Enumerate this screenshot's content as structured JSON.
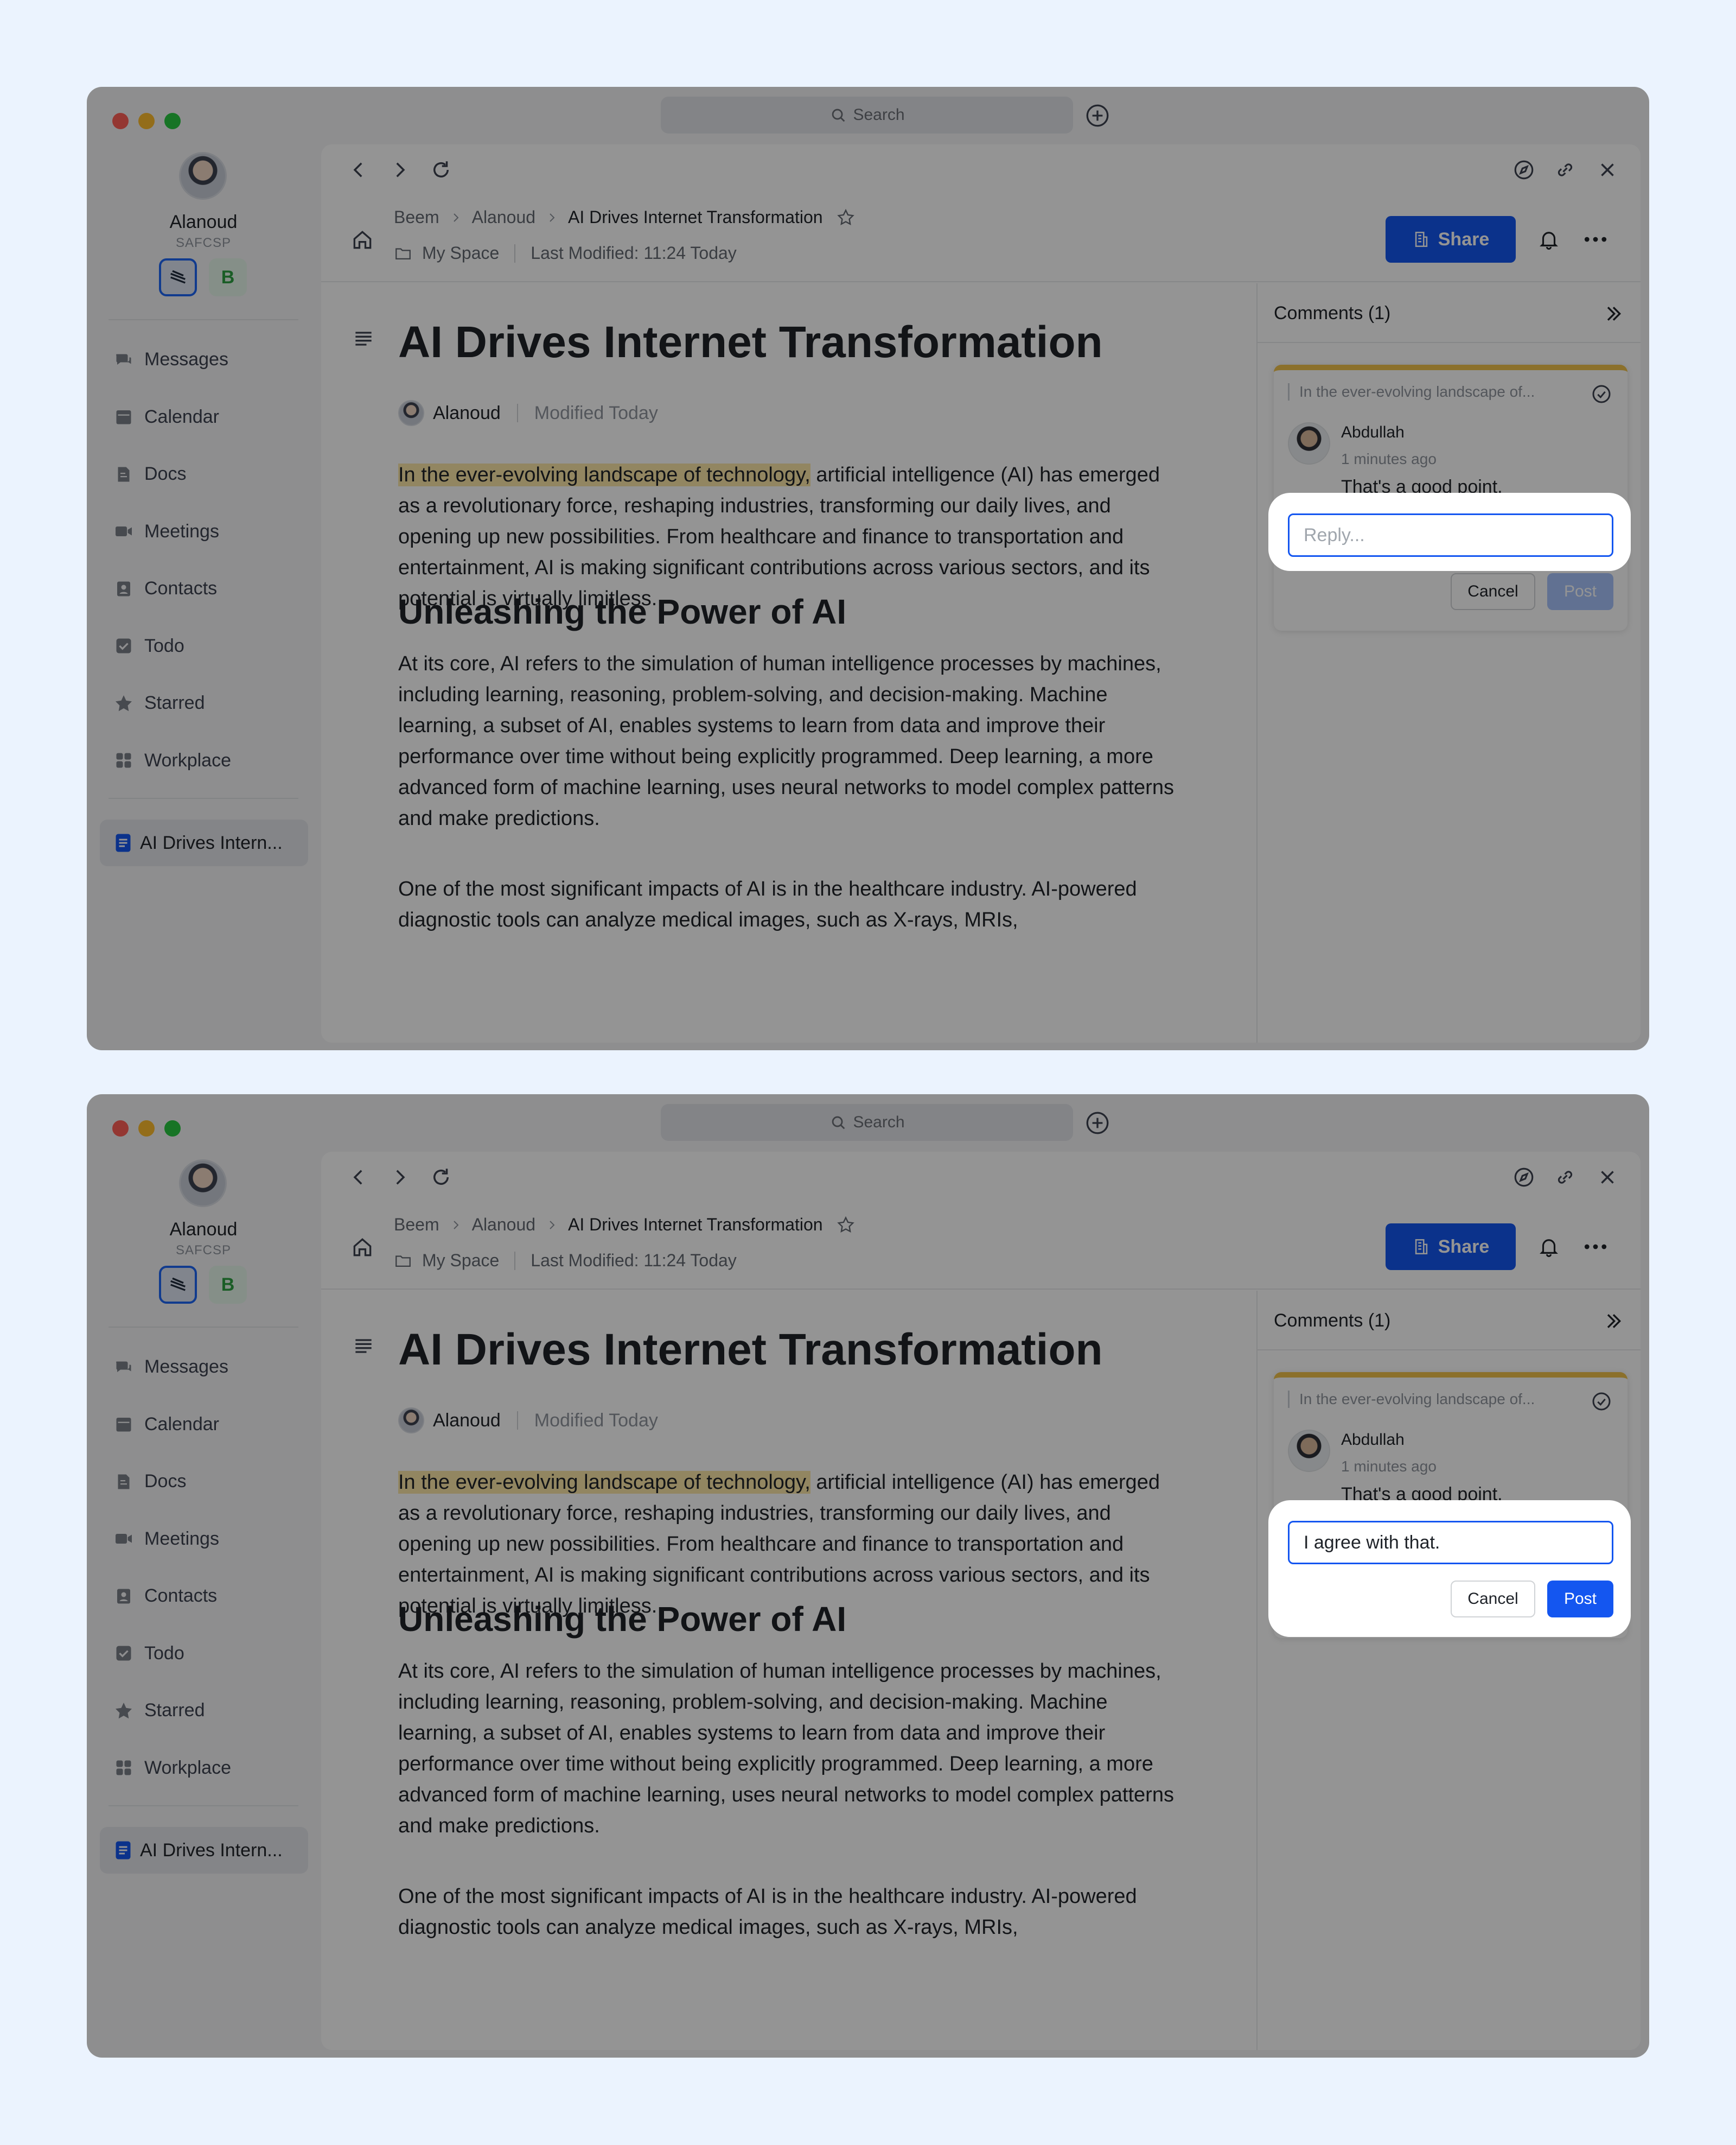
{
  "search": {
    "label": "Search"
  },
  "user": {
    "name": "Alanoud",
    "org": "SAFCSP",
    "workspace_badge": "B"
  },
  "nav": [
    {
      "label": "Messages",
      "icon": "chat-icon"
    },
    {
      "label": "Calendar",
      "icon": "calendar-icon"
    },
    {
      "label": "Docs",
      "icon": "docs-icon"
    },
    {
      "label": "Meetings",
      "icon": "video-icon"
    },
    {
      "label": "Contacts",
      "icon": "contacts-icon"
    },
    {
      "label": "Todo",
      "icon": "checkbox-icon"
    },
    {
      "label": "Starred",
      "icon": "star-icon"
    },
    {
      "label": "Workplace",
      "icon": "grid-icon"
    }
  ],
  "open_doc_tab": {
    "label": "AI Drives Intern..."
  },
  "breadcrumb": {
    "root": "Beem",
    "parent": "Alanoud",
    "current": "AI Drives Internet Transformation"
  },
  "meta": {
    "location": "My Space",
    "last_modified": "Last Modified: 11:24 Today"
  },
  "header": {
    "share_label": "Share"
  },
  "doc": {
    "title": "AI Drives Internet Transformation",
    "author": "Alanoud",
    "modified": "Modified Today",
    "p1_highlight": "In the ever-evolving landscape of technology,",
    "p1_rest": " artificial intelligence (AI) has emerged as a revolutionary force, reshaping industries, transforming our daily lives, and opening up new possibilities. From healthcare and finance to transportation and entertainment, AI is making significant contributions across various sectors, and its potential is virtually limitless.",
    "h2": "Unleashing the Power of AI",
    "p2": "At its core, AI refers to the simulation of human intelligence processes by machines, including learning, reasoning, problem-solving, and decision-making. Machine learning, a subset of AI, enables systems to learn from data and improve their performance over time without being explicitly programmed. Deep learning, a more advanced form of machine learning, uses neural networks to model complex patterns and make predictions.",
    "p3": "One of the most significant impacts of AI is in the healthcare industry. AI-powered diagnostic tools can analyze medical images, such as X-rays, MRIs,"
  },
  "comments": {
    "title": "Comments (1)",
    "quote": "In the ever-evolving landscape of...",
    "author": "Abdullah",
    "time": "1 minutes ago",
    "text": "That's a good point.",
    "reply_placeholder": "Reply...",
    "reply_value_step2": "I agree with that.",
    "cancel_label": "Cancel",
    "post_label": "Post"
  },
  "colors": {
    "accent": "#1456f0",
    "highlight": "#fbe7a8",
    "comment_marker": "#f0c24a",
    "background": "#ebf3fe"
  }
}
